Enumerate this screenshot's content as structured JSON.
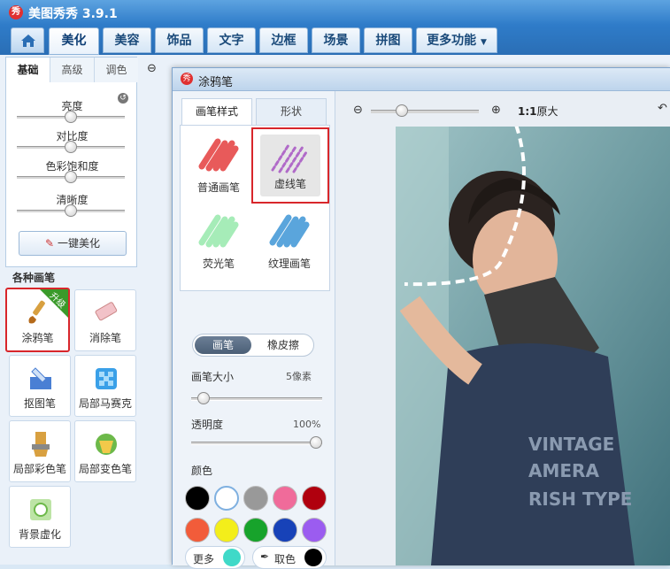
{
  "app": {
    "title": "美图秀秀 3.9.1",
    "logo_text": "秀"
  },
  "main_tabs": [
    {
      "label": "美化",
      "active": true
    },
    {
      "label": "美容"
    },
    {
      "label": "饰品"
    },
    {
      "label": "文字"
    },
    {
      "label": "边框"
    },
    {
      "label": "场景"
    },
    {
      "label": "拼图"
    },
    {
      "label": "更多功能"
    }
  ],
  "left_panel": {
    "tabs": [
      "基础",
      "高级",
      "调色"
    ],
    "sliders": [
      {
        "label": "亮度",
        "value": 0.5
      },
      {
        "label": "对比度",
        "value": 0.5
      },
      {
        "label": "色彩饱和度",
        "value": 0.5
      },
      {
        "label": "清晰度",
        "value": 0.5
      }
    ],
    "one_key_label": "一键美化",
    "section_title": "各种画笔",
    "brushes": [
      {
        "label": "涂鸦笔",
        "badge": "升级",
        "selected": true
      },
      {
        "label": "消除笔"
      },
      {
        "label": "抠图笔"
      },
      {
        "label": "局部马赛克"
      },
      {
        "label": "局部彩色笔"
      },
      {
        "label": "局部变色笔"
      },
      {
        "label": "背景虚化"
      }
    ]
  },
  "dialog": {
    "title": "涂鸦笔",
    "logo_text": "秀",
    "tabs": [
      "画笔样式",
      "形状"
    ],
    "styles": [
      {
        "label": "普通画笔"
      },
      {
        "label": "虚线笔",
        "selected": true
      },
      {
        "label": "荧光笔"
      },
      {
        "label": "纹理画笔"
      }
    ],
    "toggle": {
      "pen": "画笔",
      "eraser": "橡皮擦",
      "active": "画笔"
    },
    "size": {
      "label": "画笔大小",
      "value_text": "5像素",
      "value": 0.05
    },
    "opacity": {
      "label": "透明度",
      "value_text": "100%",
      "value": 1.0
    },
    "color_label": "颜色",
    "colors": [
      "#000000",
      "#ffffff",
      "#999999",
      "#f06b9a",
      "#b0000e",
      "#f25c3a",
      "#f3ee1a",
      "#17a32b",
      "#1742b8",
      "#9b5cf0"
    ],
    "more_label": "更多",
    "more_color": "#3fd9c8",
    "pick_label": "取色",
    "pick_color": "#000000",
    "zoom_text": "1:1",
    "zoom_suffix": "原大"
  }
}
